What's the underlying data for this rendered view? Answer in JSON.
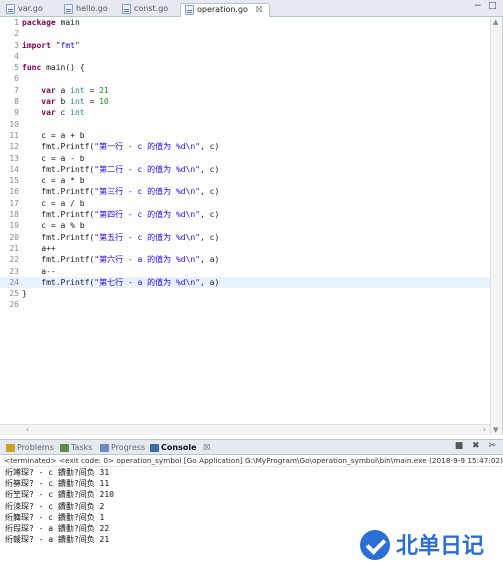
{
  "editor_tabs": [
    {
      "label": "var.go",
      "active": false
    },
    {
      "label": "hello.go",
      "active": false
    },
    {
      "label": "const.go",
      "active": false
    },
    {
      "label": "operation.go",
      "active": true,
      "close": "☒"
    }
  ],
  "window_controls": {
    "minimize": "−",
    "maximize": "□"
  },
  "code": [
    {
      "n": "1",
      "t": "package main"
    },
    {
      "n": "2",
      "t": ""
    },
    {
      "n": "3",
      "t": "import \"fmt\""
    },
    {
      "n": "4",
      "t": ""
    },
    {
      "n": "5",
      "t": "func main() {"
    },
    {
      "n": "6",
      "t": ""
    },
    {
      "n": "7",
      "t": "    var a int = 21"
    },
    {
      "n": "8",
      "t": "    var b int = 10"
    },
    {
      "n": "9",
      "t": "    var c int"
    },
    {
      "n": "10",
      "t": ""
    },
    {
      "n": "11",
      "t": "    c = a + b"
    },
    {
      "n": "12",
      "t": "    fmt.Printf(\"第一行 - c 的值为 %d\\n\", c)"
    },
    {
      "n": "13",
      "t": "    c = a - b"
    },
    {
      "n": "14",
      "t": "    fmt.Printf(\"第二行 - c 的值为 %d\\n\", c)"
    },
    {
      "n": "15",
      "t": "    c = a * b"
    },
    {
      "n": "16",
      "t": "    fmt.Printf(\"第三行 - c 的值为 %d\\n\", c)"
    },
    {
      "n": "17",
      "t": "    c = a / b"
    },
    {
      "n": "18",
      "t": "    fmt.Printf(\"第四行 - c 的值为 %d\\n\", c)"
    },
    {
      "n": "19",
      "t": "    c = a % b"
    },
    {
      "n": "20",
      "t": "    fmt.Printf(\"第五行 - c 的值为 %d\\n\", c)"
    },
    {
      "n": "21",
      "t": "    a++"
    },
    {
      "n": "22",
      "t": "    fmt.Printf(\"第六行 - a 的值为 %d\\n\", a)"
    },
    {
      "n": "23",
      "t": "    a--"
    },
    {
      "n": "24",
      "t": "    fmt.Printf(\"第七行 - a 的值为 %d\\n\", a)",
      "current": true
    },
    {
      "n": "25",
      "t": "}"
    },
    {
      "n": "26",
      "t": ""
    }
  ],
  "console_tabs": [
    {
      "label": "Problems",
      "icon": "problems-icon",
      "color": "#c9a227",
      "active": false
    },
    {
      "label": "Tasks",
      "icon": "tasks-icon",
      "color": "#5a8f4a",
      "active": false
    },
    {
      "label": "Progress",
      "icon": "progress-icon",
      "color": "#6a8cc0",
      "active": false
    },
    {
      "label": "Console",
      "icon": "console-icon",
      "color": "#3b6ea8",
      "active": true,
      "close": "☒"
    }
  ],
  "console_tools": "■ ✖ ✂",
  "console_status": "<terminated> <exit code: 0> operation_symbol [Go Application] G:\\MyProgram\\Go\\operation_symbol\\bin\\main.exe (2018-9-9 15:47:02)",
  "console_output": [
    "绗竴琛? - c 鐨勫?间负 31",
    "绗簩琛? - c 鐨勫?间负 11",
    "绗笁琛? - c 鐨勫?间负 210",
    "绗洓琛? - c 鐨勫?间负 2",
    "绗簲琛? - c 鐨勫?间负 1",
    "绗叚琛? - a 鐨勫?间负 22",
    "绗竷琛? - a 鐨勫?间负 21"
  ],
  "watermark": "北单日记",
  "colors": {
    "keyword": "#7f0055",
    "string": "#2a00ff",
    "number": "#1f8c1f",
    "accent": "#2b6fd6"
  }
}
